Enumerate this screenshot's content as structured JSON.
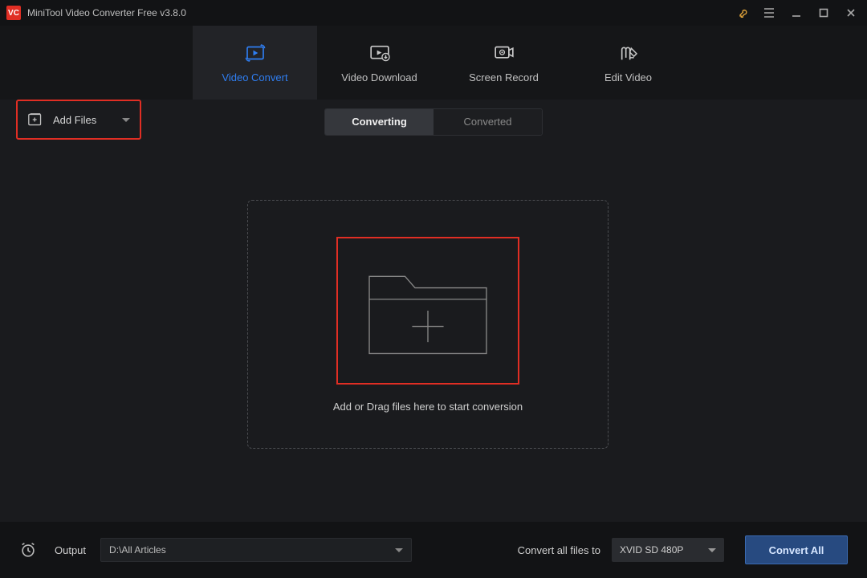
{
  "titlebar": {
    "logo_text": "VC",
    "title": "MiniTool Video Converter Free v3.8.0"
  },
  "nav": {
    "tabs": [
      {
        "label": "Video Convert"
      },
      {
        "label": "Video Download"
      },
      {
        "label": "Screen Record"
      },
      {
        "label": "Edit Video"
      }
    ]
  },
  "toolbar": {
    "add_files_label": "Add Files",
    "segments": {
      "converting": "Converting",
      "converted": "Converted"
    }
  },
  "dropzone": {
    "hint": "Add or Drag files here to start conversion"
  },
  "bottombar": {
    "output_label": "Output",
    "output_path": "D:\\All Articles",
    "convert_all_label": "Convert all files to",
    "format_selected": "XVID SD 480P",
    "convert_all_button": "Convert All"
  }
}
